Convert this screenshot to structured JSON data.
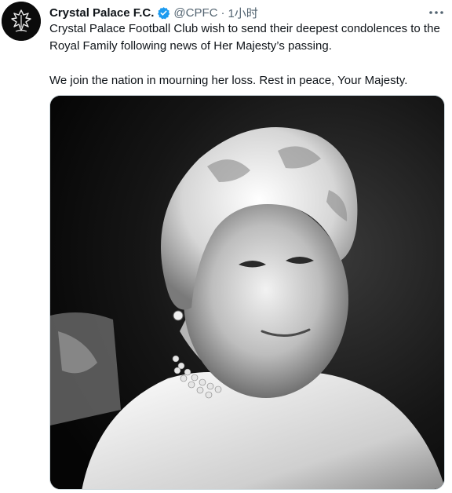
{
  "tweet": {
    "author_name": "Crystal Palace F.C.",
    "author_handle": "@CPFC",
    "separator": "·",
    "timestamp": "1小时",
    "verified": true,
    "text_lines": [
      "Crystal Palace Football Club wish to send their deepest condolences to the Royal Family following news of Her Majesty’s passing.",
      "We join the nation in mourning her loss. Rest in peace, Your Majesty."
    ],
    "avatar_icon": "eagle-crest-icon",
    "more_icon": "more-options-icon",
    "photo": "black-and-white-portrait-photo"
  },
  "colors": {
    "verified_blue": "#1d9bf0",
    "secondary_text": "#536471",
    "primary_text": "#0f1419",
    "avatar_bg": "#0b0b0b"
  }
}
